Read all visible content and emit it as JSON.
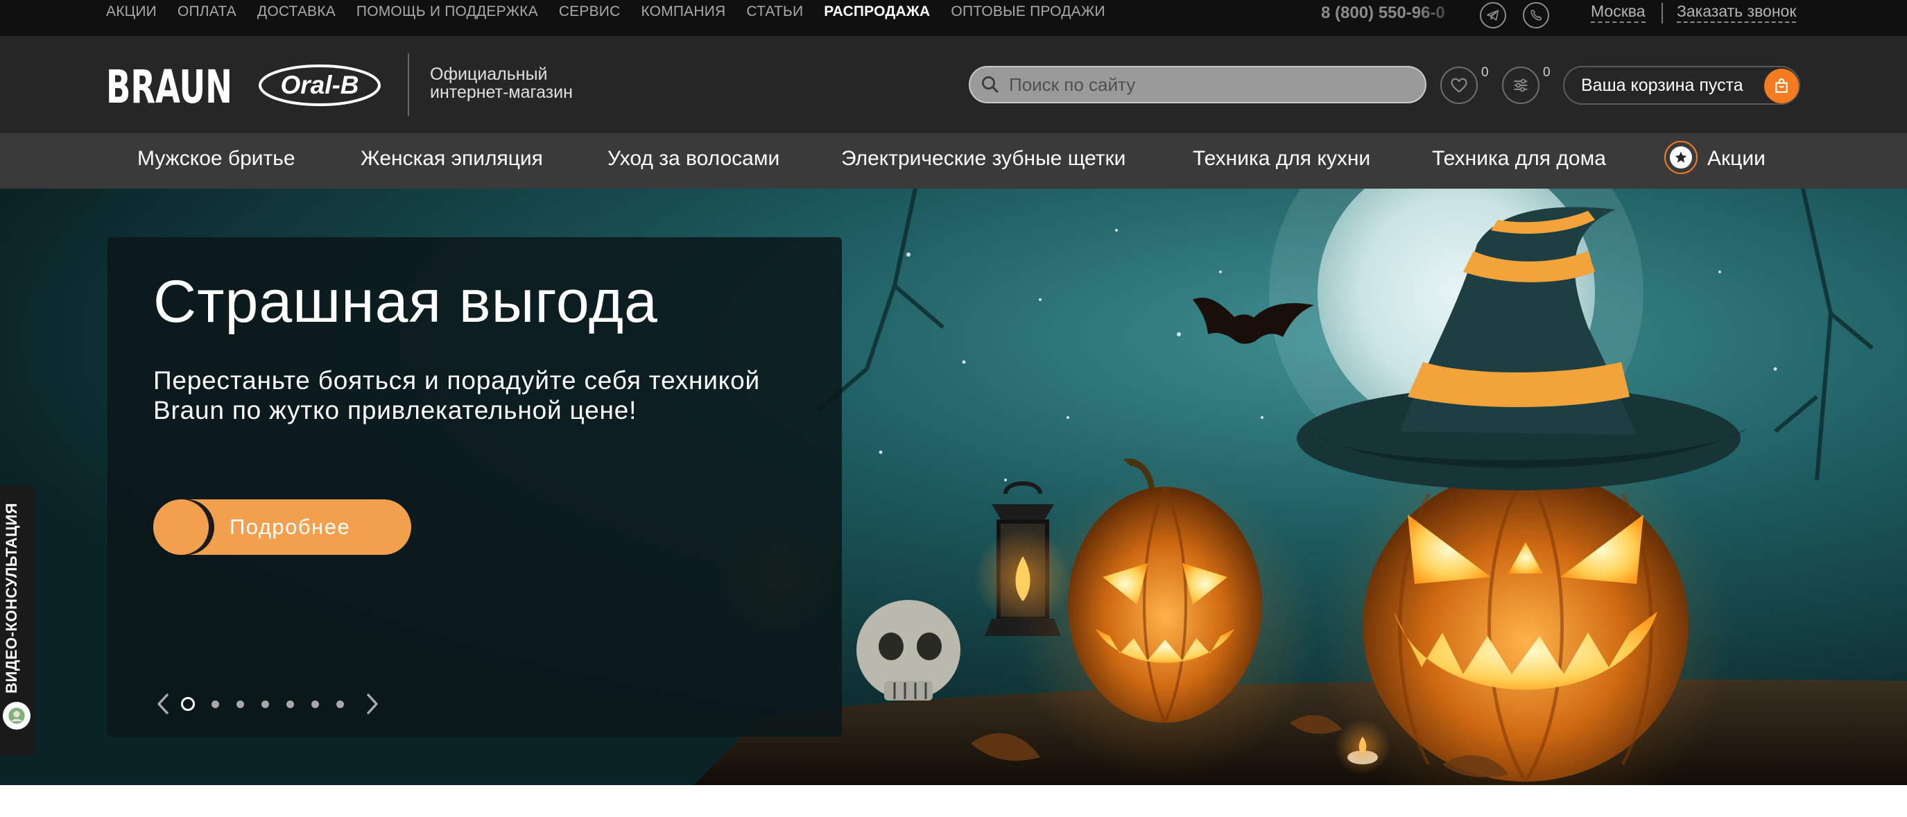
{
  "top_nav": {
    "items": [
      {
        "label": "АКЦИИ",
        "active": false
      },
      {
        "label": "ОПЛАТА",
        "active": false
      },
      {
        "label": "ДОСТАВКА",
        "active": false
      },
      {
        "label": "ПОМОЩЬ И ПОДДЕРЖКА",
        "active": false
      },
      {
        "label": "СЕРВИС",
        "active": false
      },
      {
        "label": "КОМПАНИЯ",
        "active": false
      },
      {
        "label": "СТАТЬИ",
        "active": false
      },
      {
        "label": "РАСПРОДАЖА",
        "active": true
      },
      {
        "label": "ОПТОВЫЕ ПРОДАЖИ",
        "active": false
      }
    ],
    "phone": "8 (800) 550-96-0",
    "city": "Москва",
    "callback": "Заказать звонок"
  },
  "header": {
    "logo_braun": "BRAUN",
    "logo_oralb": "Oral-B",
    "shop_label_line1": "Официальный",
    "shop_label_line2": "интернет-магазин",
    "search_placeholder": "Поиск по сайту",
    "favorites_count": "0",
    "compare_count": "0",
    "cart_label": "Ваша корзина пуста"
  },
  "categories": [
    "Мужское бритье",
    "Женская эпиляция",
    "Уход за волосами",
    "Электрические зубные щетки",
    "Техника для кухни",
    "Техника для дома"
  ],
  "promo_label": "Акции",
  "hero": {
    "title": "Страшная выгода",
    "text": "Перестаньте бояться и порадуйте себя техникой Braun по жутко привлекательной цене!",
    "button": "Подробнее",
    "slide_count": 7,
    "active_slide": 1
  },
  "video_tab": {
    "label": "ВИДЕО-КОНСУЛЬТАЦИЯ"
  },
  "colors": {
    "accent": "#f47b20",
    "hero_button": "#f2a04e",
    "header_bg": "#262626",
    "catnav_bg": "#3a3a3a",
    "topbar_bg": "#101010"
  }
}
